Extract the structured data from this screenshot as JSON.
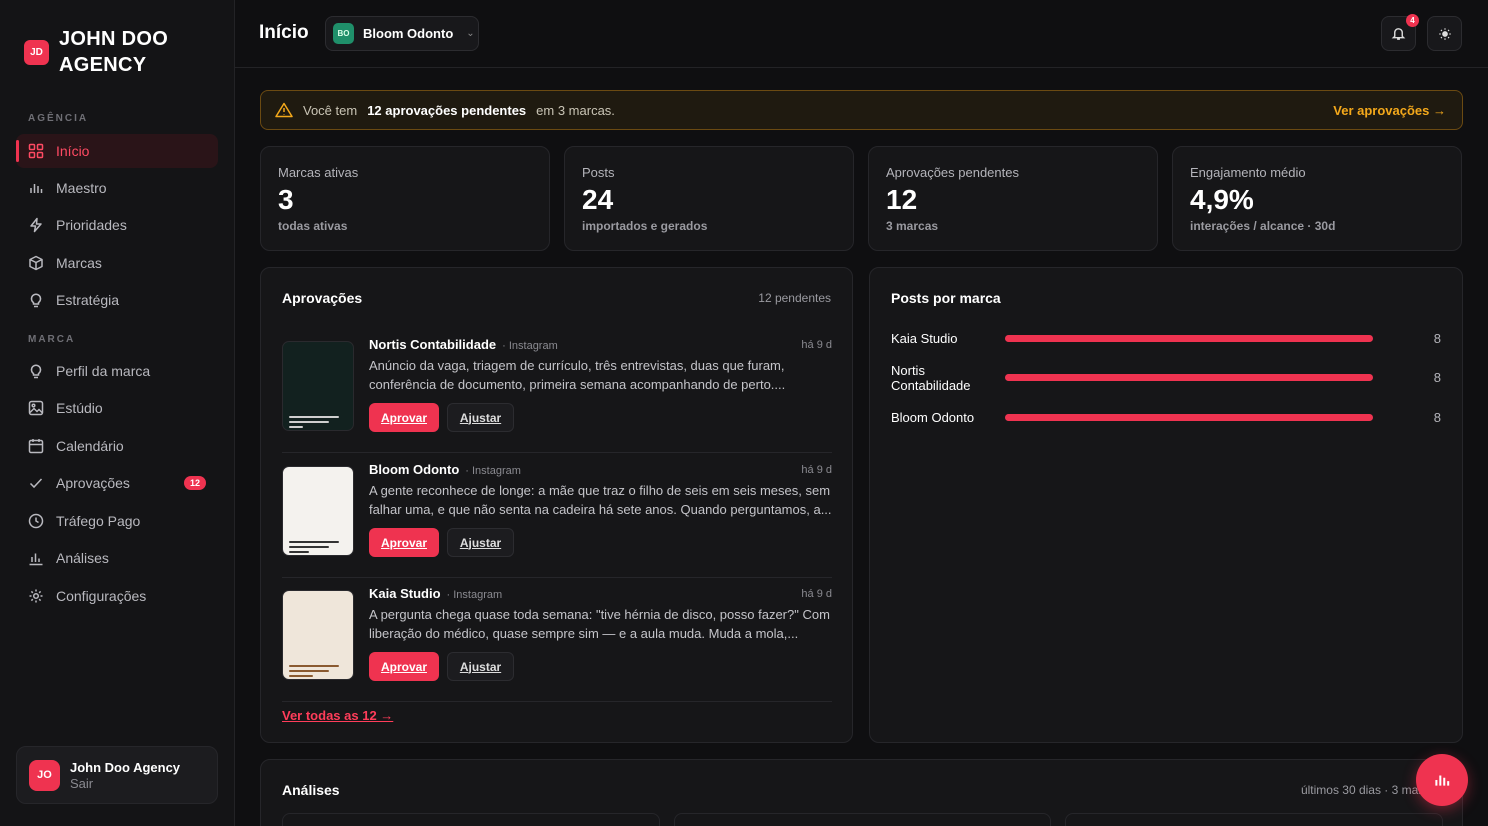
{
  "agency": {
    "badge": "JD",
    "name_line1": "JOHN DOO",
    "name_line2": "AGENCY"
  },
  "sidebar": {
    "sections": {
      "agency": "AGÊNCIA",
      "brand": "MARCA"
    },
    "items": [
      {
        "label": "Início",
        "icon": "grid-icon",
        "active": true
      },
      {
        "label": "Maestro",
        "icon": "bars-icon"
      },
      {
        "label": "Prioridades",
        "icon": "bolt-icon"
      },
      {
        "label": "Marcas",
        "icon": "cube-icon"
      },
      {
        "label": "Estratégia",
        "icon": "bulb-icon"
      },
      {
        "label": "Perfil da marca",
        "icon": "bulb-icon"
      },
      {
        "label": "Estúdio",
        "icon": "image-icon"
      },
      {
        "label": "Calendário",
        "icon": "calendar-icon"
      },
      {
        "label": "Aprovações",
        "icon": "check-icon",
        "badge": "12"
      },
      {
        "label": "Tráfego Pago",
        "icon": "clock-icon"
      },
      {
        "label": "Análises",
        "icon": "chart-icon"
      },
      {
        "label": "Configurações",
        "icon": "gear-icon"
      }
    ]
  },
  "account": {
    "avatar": "JO",
    "name": "John Doo Agency",
    "action": "Sair"
  },
  "topbar": {
    "title": "Início",
    "brand": {
      "initials": "BO",
      "name": "Bloom Odonto"
    },
    "notifications": "4"
  },
  "alert": {
    "prefix": "Você tem",
    "highlight": "12 aprovações pendentes",
    "suffix": "em 3 marcas.",
    "link": "Ver aprovações →"
  },
  "stats": [
    {
      "label": "Marcas ativas",
      "value": "3",
      "sub": "todas ativas"
    },
    {
      "label": "Posts",
      "value": "24",
      "sub": "importados e gerados"
    },
    {
      "label": "Aprovações pendentes",
      "value": "12",
      "sub": "3 marcas"
    },
    {
      "label": "Engajamento médio",
      "value": "4,9%",
      "sub": "interações / alcance · 30d"
    }
  ],
  "approvals": {
    "title": "Aprovações",
    "meta": "12 pendentes",
    "approve_label": "Aprovar",
    "adjust_label": "Ajustar",
    "see_all": "Ver todas as 12 →",
    "items": [
      {
        "brand": "Nortis Contabilidade",
        "channel": "· Instagram",
        "time": "há 9 d",
        "text": "Anúncio da vaga, triagem de currículo, três entrevistas, duas que furam, conferência de documento, primeira semana acompanhando de perto....",
        "thumb_color": "#12211f"
      },
      {
        "brand": "Bloom Odonto",
        "channel": "· Instagram",
        "time": "há 9 d",
        "text": "A gente reconhece de longe: a mãe que traz o filho de seis em seis meses, sem falhar uma, e que não senta na cadeira há sete anos. Quando perguntamos, a...",
        "thumb_color": "#f4f2ee"
      },
      {
        "brand": "Kaia Studio",
        "channel": "· Instagram",
        "time": "há 9 d",
        "text": "A pergunta chega quase toda semana: \"tive hérnia de disco, posso fazer?\" Com liberação do médico, quase sempre sim — e a aula muda. Muda a mola,...",
        "thumb_color": "#efe6da"
      }
    ]
  },
  "posts_by_brand": {
    "title": "Posts por marca",
    "rows": [
      {
        "label": "Kaia Studio",
        "value": 8,
        "max": 8
      },
      {
        "label": "Nortis Contabilidade",
        "value": 8,
        "max": 8
      },
      {
        "label": "Bloom Odonto",
        "value": 8,
        "max": 8
      }
    ]
  },
  "analytics": {
    "title": "Análises",
    "meta": "últimos 30 dias · 3 marcas"
  },
  "colors": {
    "accent": "#ef3350",
    "warning": "#f3a81b",
    "background": "#0f0f11"
  }
}
